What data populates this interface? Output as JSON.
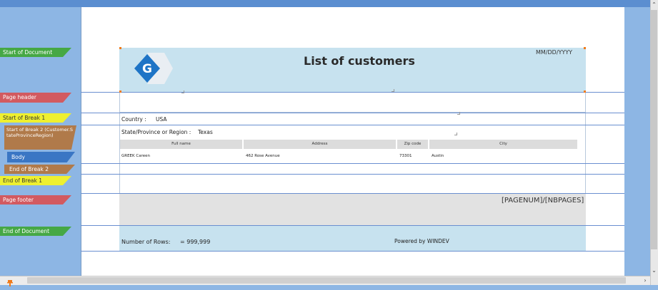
{
  "bands": {
    "start_of_document": "Start of Document",
    "page_header": "Page header",
    "start_of_break_1": "Start of Break 1",
    "start_of_break_2": "Start of Break 2 (Customer.StateProvinceRegion)",
    "body": "Body",
    "end_of_break_2": "End of Break 2",
    "end_of_break_1": "End of Break 1",
    "page_footer": "Page footer",
    "end_of_document": "End of Document"
  },
  "report": {
    "title": "List of customers",
    "date": "MM/DD/YYYY",
    "logo_letter": "G",
    "country_label": "Country :",
    "country_value": "USA",
    "state_label": "State/Province or Region :",
    "state_value": "Texas",
    "columns": [
      "Full name",
      "Address",
      "Zip code",
      "City"
    ],
    "row": [
      "GREEK Careen",
      "462 Rose Avenue",
      "73301",
      "Austin"
    ],
    "page_number": "[PAGENUM]/[NBPAGES]",
    "rows_label": "Number of Rows:",
    "rows_value": "= 999,999",
    "powered_by": "Powered by WINDEV"
  },
  "colors": {
    "band_green": "#46a845",
    "band_red": "#d25a60",
    "band_yellow": "#eef030",
    "band_brown": "#b07a4a",
    "band_blue": "#3a76c4",
    "header_band": "#c7e2ef",
    "logo_blue": "#1e74c6"
  }
}
